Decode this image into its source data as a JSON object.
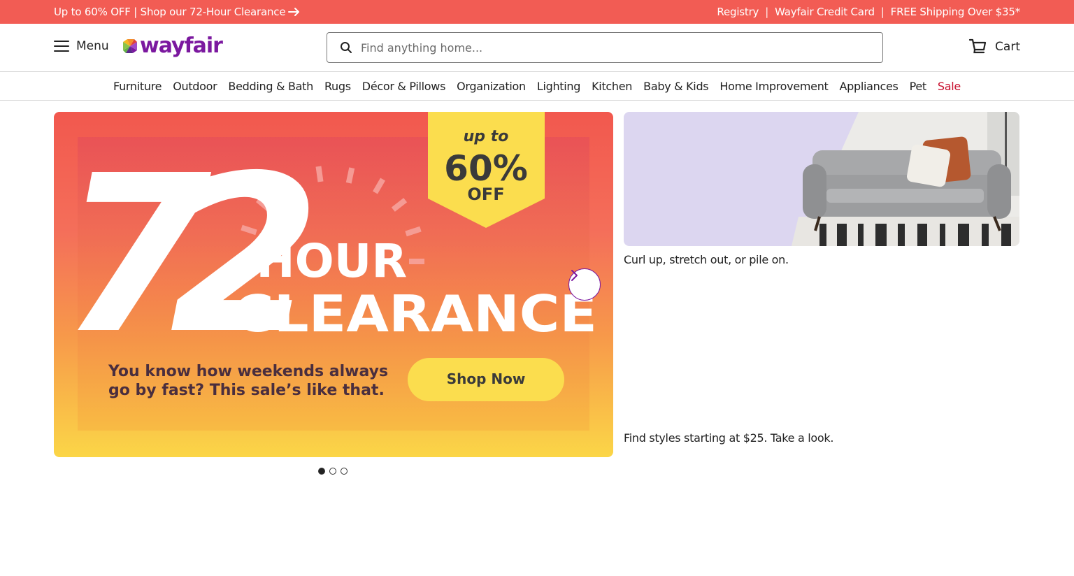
{
  "promo": {
    "left_text": "Up to 60% OFF | Shop our 72-Hour Clearance",
    "right_links": [
      "Registry",
      "Wayfair Credit Card",
      "FREE Shipping Over $35*"
    ],
    "separator": "|"
  },
  "header": {
    "menu_label": "Menu",
    "logo_text": "wayfair",
    "search_placeholder": "Find anything home...",
    "cart_label": "Cart"
  },
  "categories": [
    "Furniture",
    "Outdoor",
    "Bedding & Bath",
    "Rugs",
    "Décor & Pillows",
    "Organization",
    "Lighting",
    "Kitchen",
    "Baby & Kids",
    "Home Improvement",
    "Appliances",
    "Pet",
    "Sale"
  ],
  "hero": {
    "big_number": "72",
    "headline_line1": "-HOUR",
    "headline_line2": "CLEARANCE",
    "badge_line1": "up to",
    "badge_line2": "60%",
    "badge_line3": "OFF",
    "body_line1": "You know how weekends always",
    "body_line2": "go by fast? This sale’s like that.",
    "cta_label": "Shop Now",
    "slide_count": 3,
    "active_slide": 1
  },
  "side_cards": [
    {
      "caption": "Curl up, stretch out, or pile on."
    },
    {
      "caption": "Find styles starting at $25. Take a look."
    }
  ],
  "colors": {
    "promo_bg": "#f25c54",
    "brand_purple": "#7b189f",
    "sale_red": "#c8102e",
    "hero_yellow": "#fbdd4e"
  }
}
